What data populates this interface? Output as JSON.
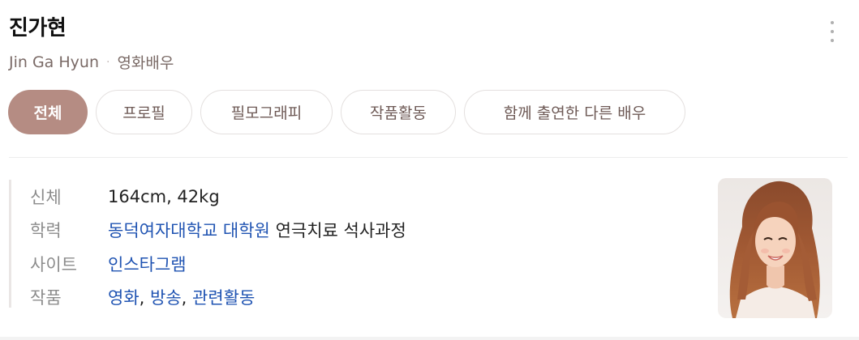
{
  "profile": {
    "name": "진가현",
    "romanized_name": "Jin Ga Hyun",
    "occupation": "영화배우",
    "separator": "·"
  },
  "tabs": [
    {
      "label": "전체",
      "active": true
    },
    {
      "label": "프로필",
      "active": false
    },
    {
      "label": "필모그래피",
      "active": false
    },
    {
      "label": "작품활동",
      "active": false
    },
    {
      "label": "함께 출연한 다른 배우",
      "active": false
    }
  ],
  "info": {
    "body": {
      "label": "신체",
      "value": "164cm, 42kg"
    },
    "education": {
      "label": "학력",
      "link": "동덕여자대학교 대학원",
      "rest": "연극치료 석사과정"
    },
    "site": {
      "label": "사이트",
      "link": "인스타그램"
    },
    "works": {
      "label": "작품",
      "links": [
        "영화",
        "방송",
        "관련활동"
      ],
      "separator": ", "
    }
  },
  "colors": {
    "accent": "#b58c83",
    "link": "#1f53b2",
    "label": "#8c8c8c",
    "subtitle": "#7a6a66"
  },
  "icons": {
    "more": "vertical-ellipsis-icon"
  }
}
